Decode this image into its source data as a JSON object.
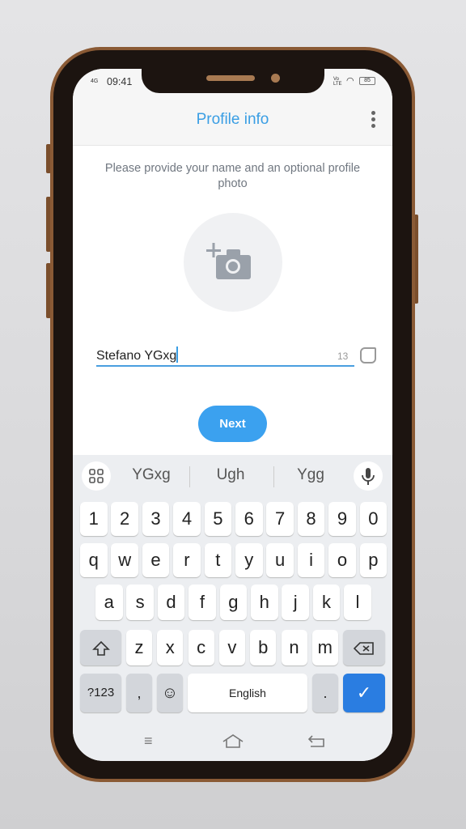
{
  "status": {
    "network": "4G",
    "time": "09:41",
    "volte": "Vo LTE",
    "battery": "85"
  },
  "header": {
    "title": "Profile info",
    "menu_icon": "more-vertical-icon"
  },
  "prompt": "Please provide your name and an optional profile photo",
  "avatar": {
    "icon": "add-photo-icon"
  },
  "name_field": {
    "value": "Stefano YGxg",
    "remaining": "13",
    "emoji_icon": "sticker-icon"
  },
  "next_label": "Next",
  "accent": "#3ba1ef",
  "keyboard": {
    "suggestions": [
      "YGxg",
      "Ugh",
      "Ygg"
    ],
    "rows": [
      [
        "1",
        "2",
        "3",
        "4",
        "5",
        "6",
        "7",
        "8",
        "9",
        "0"
      ],
      [
        "q",
        "w",
        "e",
        "r",
        "t",
        "y",
        "u",
        "i",
        "o",
        "p"
      ],
      [
        "a",
        "s",
        "d",
        "f",
        "g",
        "h",
        "j",
        "k",
        "l"
      ],
      [
        "z",
        "x",
        "c",
        "v",
        "b",
        "n",
        "m"
      ]
    ],
    "symbols": "?123",
    "comma": ",",
    "space": "English",
    "period": "."
  }
}
